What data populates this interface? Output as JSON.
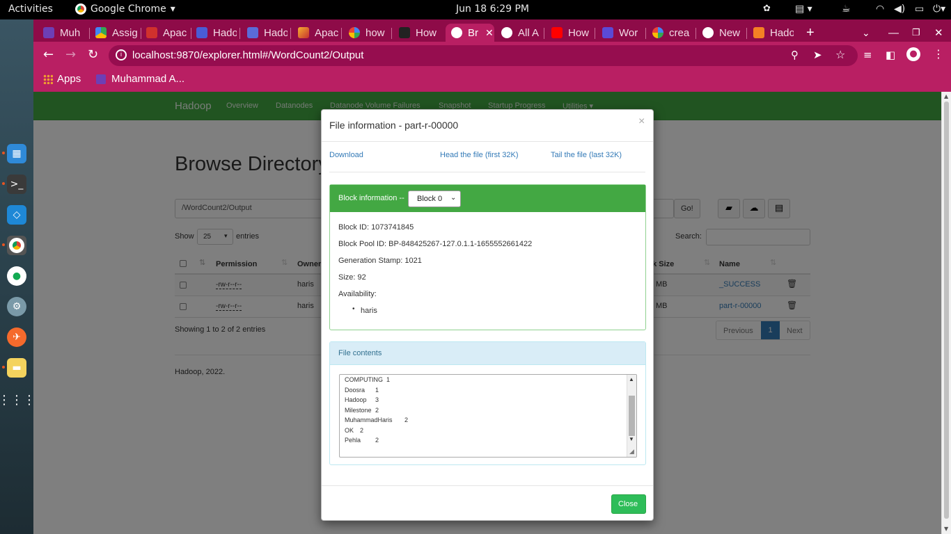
{
  "topbar": {
    "activities": "Activities",
    "app": "Google Chrome",
    "clock": "Jun 18   6:29 PM"
  },
  "tabs": [
    {
      "label": "Muh",
      "icon_color": "#6d3fb5"
    },
    {
      "label": "Assig",
      "icon_color": "#34a853"
    },
    {
      "label": "Apac",
      "icon_color": "#d0312d"
    },
    {
      "label": "Hado",
      "icon_color": "#4a5cd6"
    },
    {
      "label": "Hado",
      "icon_color": "#5b6bd8"
    },
    {
      "label": "Apac",
      "icon_color": "#c62f2f"
    },
    {
      "label": "how",
      "icon_color": "#4285f4"
    },
    {
      "label": "How",
      "icon_color": "#333333"
    },
    {
      "label": "Br",
      "icon_color": "#ffffff"
    },
    {
      "label": "All A",
      "icon_color": "#ffffff"
    },
    {
      "label": "How",
      "icon_color": "#ff0000"
    },
    {
      "label": "Wor",
      "icon_color": "#5b4ad6"
    },
    {
      "label": "crea",
      "icon_color": "#4285f4"
    },
    {
      "label": "New",
      "icon_color": "#ffffff"
    },
    {
      "label": "Hado",
      "icon_color": "#f48024"
    }
  ],
  "address": {
    "url": "localhost:9870/explorer.html#/WordCount2/Output"
  },
  "bookmarks": {
    "apps": "Apps",
    "item": "Muhammad A..."
  },
  "hadoop_nav": {
    "brand": "Hadoop",
    "items": [
      "Overview",
      "Datanodes",
      "Datanode Volume Failures",
      "Snapshot",
      "Startup Progress",
      "Utilities ▾"
    ]
  },
  "browse": {
    "title": "Browse Directory",
    "path": "/WordCount2/Output",
    "go": "Go!",
    "show": "Show",
    "entries_count": "25",
    "entries": "entries",
    "search": "Search:",
    "columns": [
      "Permission",
      "Owner",
      "ck Size",
      "Name"
    ],
    "rows": [
      {
        "perm": "-rw-r--r--",
        "owner": "haris",
        "size": "MB",
        "name": "_SUCCESS"
      },
      {
        "perm": "-rw-r--r--",
        "owner": "haris",
        "size": "MB",
        "name": "part-r-00000"
      }
    ],
    "showing": "Showing 1 to 2 of 2 entries",
    "pagination": {
      "prev": "Previous",
      "page": "1",
      "next": "Next"
    },
    "footer": "Hadoop, 2022."
  },
  "modal": {
    "title": "File information - part-r-00000",
    "close_x": "×",
    "download": "Download",
    "head": "Head the file (first 32K)",
    "tail": "Tail the file (last 32K)",
    "block_label": "Block information --",
    "block_select": "Block 0",
    "block_id": "Block ID: 1073741845",
    "pool_id": "Block Pool ID: BP-848425267-127.0.1.1-1655552661422",
    "gen_stamp": "Generation Stamp: 1021",
    "size": "Size: 92",
    "availability": "Availability:",
    "avail_host": "haris",
    "contents_label": "File contents",
    "contents": [
      {
        "word": "COMPUTING",
        "count": "1"
      },
      {
        "word": "Doosra",
        "count": "1"
      },
      {
        "word": "Hadoop",
        "count": "3"
      },
      {
        "word": "Milestone",
        "count": "2"
      },
      {
        "word": "MuhammadHaris",
        "count": "2"
      },
      {
        "word": "OK",
        "count": "2"
      },
      {
        "word": "Pehla",
        "count": "2"
      }
    ],
    "close_btn": "Close"
  },
  "colors": {
    "chrome_dark": "#8e0b48",
    "chrome": "#b91f63",
    "hadoop_green": "#43a843",
    "close_green": "#2ebd59",
    "panel_blue": "#d9edf7"
  }
}
